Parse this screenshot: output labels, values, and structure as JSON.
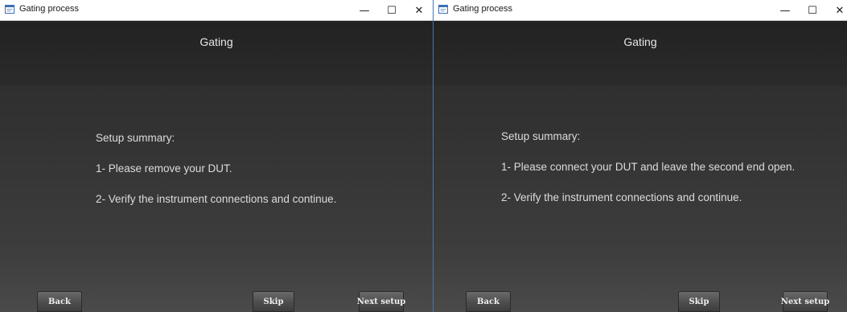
{
  "windows": [
    {
      "title": "Gating process",
      "heading": "Gating",
      "summary_label": "Setup summary:",
      "steps": [
        "1- Please remove your DUT.",
        "2- Verify the instrument connections and continue."
      ],
      "buttons": {
        "back": "Back",
        "skip": "Skip",
        "next": "Next setup"
      }
    },
    {
      "title": "Gating process",
      "heading": "Gating",
      "summary_label": "Setup summary:",
      "steps": [
        "1- Please connect your DUT and leave the second end open.",
        "2- Verify the instrument connections and continue."
      ],
      "buttons": {
        "back": "Back",
        "skip": "Skip",
        "next": "Next setup"
      }
    }
  ],
  "window_controls": {
    "minimize": "—",
    "maximize": "☐",
    "close": "✕"
  },
  "colors": {
    "accent_border": "#2e7bcf",
    "client_background": "#333333",
    "text": "#dcdcdc"
  },
  "icons": {
    "app": "app-icon",
    "minimize": "minimize-icon",
    "maximize": "maximize-icon",
    "close": "close-icon"
  }
}
